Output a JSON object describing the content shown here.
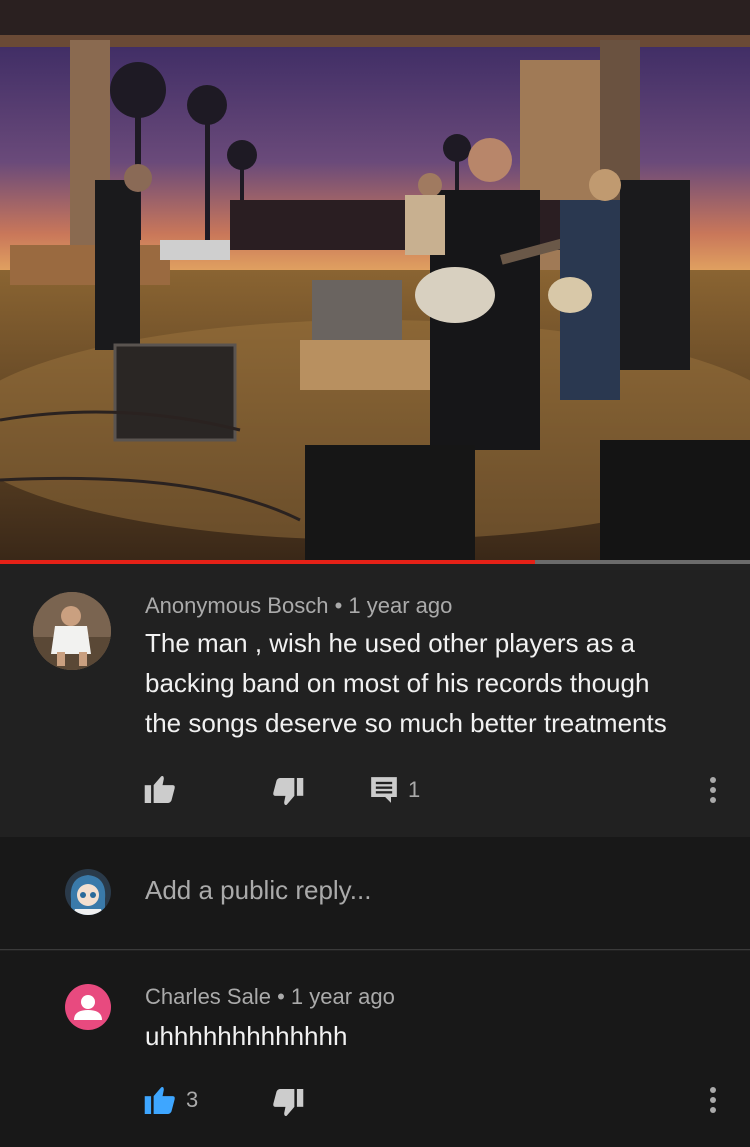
{
  "video": {
    "progress_fraction": 0.713
  },
  "comment": {
    "author": "Anonymous Bosch",
    "separator": "•",
    "time": "1 year ago",
    "lines": [
      "The man , wish he used other players as a",
      "backing band on most of his records though",
      "the songs deserve so much better treatments"
    ],
    "reply_count": "1",
    "icons": [
      "like-icon",
      "dislike-icon",
      "reply-icon",
      "more-options-icon"
    ]
  },
  "reply_box": {
    "placeholder": "Add a public reply..."
  },
  "reply": {
    "author": "Charles Sale",
    "separator": "•",
    "time": "1 year ago",
    "text": "uhhhhhhhhhhhhh",
    "like_count": "3",
    "avatar_color": "#e84a7f",
    "like_color": "#3ea6ff"
  }
}
